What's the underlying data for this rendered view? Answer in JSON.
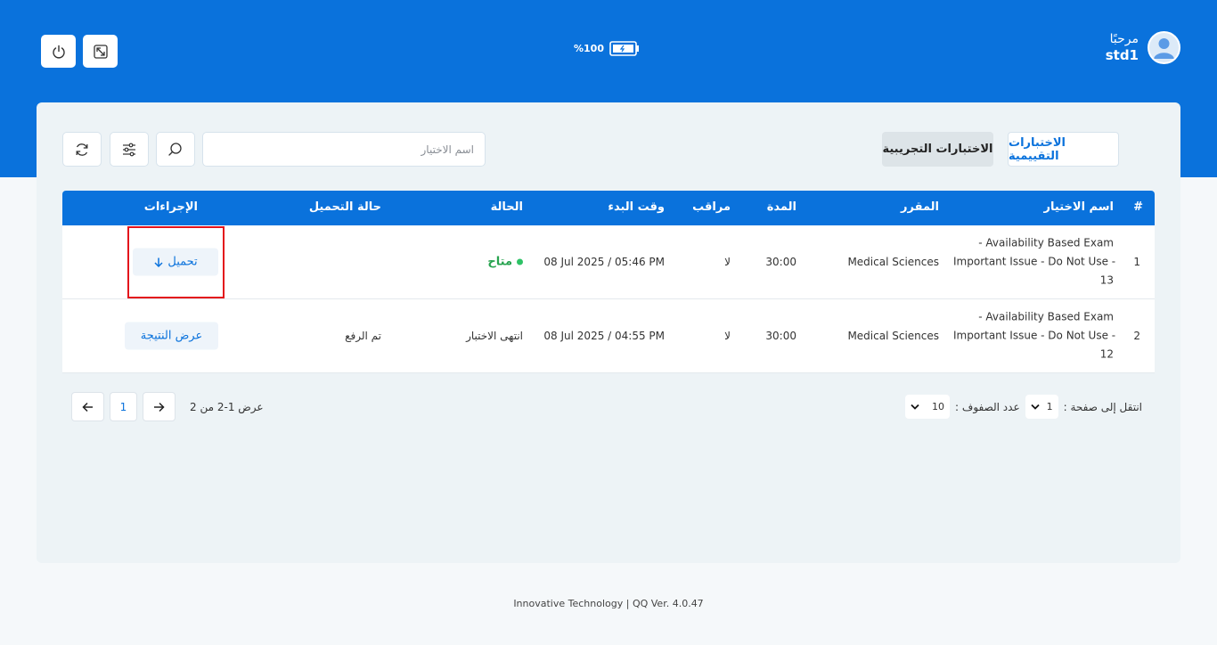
{
  "header": {
    "greeting": "مرحبًا",
    "username": "std1",
    "battery_percent": "%100"
  },
  "tabs": [
    {
      "label": "الاختبارات التقييمية",
      "active": true
    },
    {
      "label": "الاختبارات التجريبية",
      "active": false
    }
  ],
  "search": {
    "placeholder": "اسم الاختيار"
  },
  "table": {
    "columns": [
      "#",
      "اسم الاختيار",
      "المقرر",
      "المدة",
      "مراقب",
      "وقت البدء",
      "الحالة",
      "حالة التحميل",
      "الإجراءات"
    ],
    "rows": [
      {
        "num": "1",
        "name_lines": [
          "- Availability Based Exam",
          "Important Issue - Do Not Use -",
          "13"
        ],
        "course": "Medical Sciences",
        "duration": "30:00",
        "proctored": "لا",
        "start_time": "08 Jul 2025 / 05:46 PM",
        "status": "متاح",
        "upload_status": "",
        "action": "تحميل"
      },
      {
        "num": "2",
        "name_lines": [
          "- Availability Based Exam",
          "Important Issue - Do Not Use -",
          "12"
        ],
        "course": "Medical Sciences",
        "duration": "30:00",
        "proctored": "لا",
        "start_time": "08 Jul 2025 / 04:55 PM",
        "status": "انتهى الاختبار",
        "upload_status": "تم الرفع",
        "action": "عرض النتيجة"
      }
    ]
  },
  "pagination": {
    "goto_label": "انتقل إلى صفحة :",
    "goto_value": "1",
    "rows_label": "عدد الصفوف :",
    "rows_value": "10",
    "showing": "عرض 1-2 من 2",
    "current_page": "1"
  },
  "footer": "Innovative Technology | QQ Ver. 4.0.47",
  "colors": {
    "primary": "#0a72dc",
    "available": "#2ec266",
    "highlight": "#e3121b"
  }
}
